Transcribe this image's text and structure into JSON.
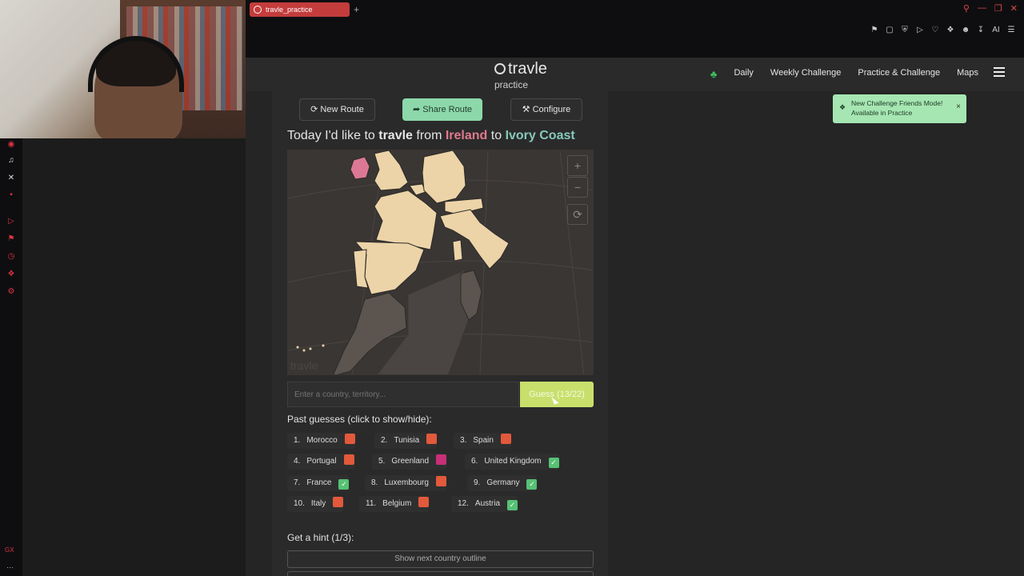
{
  "browser": {
    "tab_title": "travle_practice",
    "new_tab": "+",
    "toolbar_ai_label": "AI"
  },
  "site": {
    "logo": "travle",
    "subtitle": "practice",
    "nav": [
      "Daily",
      "Weekly Challenge",
      "Practice & Challenge",
      "Maps"
    ]
  },
  "toast": {
    "line1": "New Challenge Friends Mode!",
    "line2": "Available in Practice",
    "close": "×"
  },
  "actions": {
    "new_route": "New Route",
    "share_route": "Share Route",
    "configure": "Configure"
  },
  "headline": {
    "prefix": "Today I'd like to",
    "brand": "travle",
    "from_word": "from",
    "from_country": "Ireland",
    "to_word": "to",
    "to_country": "Ivory Coast"
  },
  "map": {
    "zoom_in": "+",
    "zoom_out": "−",
    "reset": "⟳",
    "watermark": "travle"
  },
  "guess": {
    "placeholder": "Enter a country, territory...",
    "button": "Guess (13/22)"
  },
  "past": {
    "title": "Past guesses (click to show/hide):",
    "items": [
      {
        "num": "1.",
        "name": "Morocco",
        "status": "red"
      },
      {
        "num": "2.",
        "name": "Tunisia",
        "status": "red"
      },
      {
        "num": "3.",
        "name": "Spain",
        "status": "red"
      },
      {
        "num": "4.",
        "name": "Portugal",
        "status": "red"
      },
      {
        "num": "5.",
        "name": "Greenland",
        "status": "pink"
      },
      {
        "num": "6.",
        "name": "United Kingdom",
        "status": "check"
      },
      {
        "num": "7.",
        "name": "France",
        "status": "check"
      },
      {
        "num": "8.",
        "name": "Luxembourg",
        "status": "red"
      },
      {
        "num": "9.",
        "name": "Germany",
        "status": "check"
      },
      {
        "num": "10.",
        "name": "Italy",
        "status": "red"
      },
      {
        "num": "11.",
        "name": "Belgium",
        "status": "red"
      },
      {
        "num": "12.",
        "name": "Austria",
        "status": "check"
      }
    ]
  },
  "hint": {
    "title": "Get a hint (1/3):",
    "button": "Show next country outline"
  },
  "colors": {
    "accent_green": "#8dd8aa",
    "guess_button": "#c8df6c",
    "from_country": "#e07a8d",
    "to_country": "#86c9b8"
  }
}
